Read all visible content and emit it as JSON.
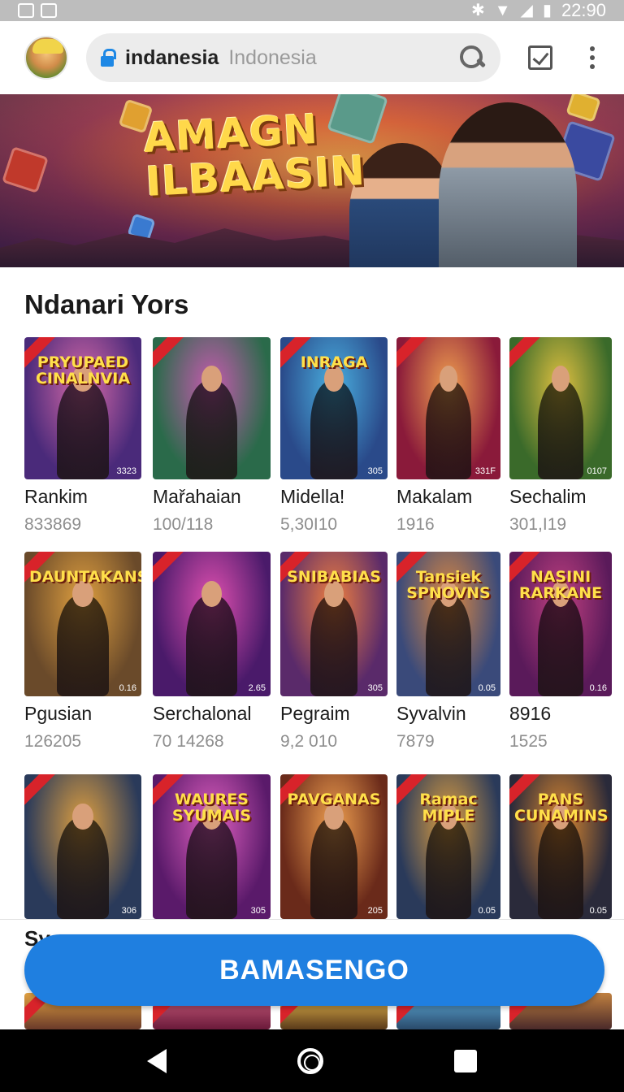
{
  "status_bar": {
    "time": "22:90",
    "icons": [
      "notification-icon",
      "notification-icon",
      "bluetooth-icon",
      "wifi-icon",
      "signal-icon",
      "battery-icon"
    ]
  },
  "app_bar": {
    "search_query": "indanesia",
    "search_hint": "Indonesia",
    "icons": [
      "avatar",
      "lock-icon",
      "search-icon",
      "checkbox-icon",
      "more-vert-icon"
    ]
  },
  "banner": {
    "title_line1": "AMAGN",
    "title_line2": "ILBAASIN"
  },
  "section": {
    "title": "Ndanari Yors"
  },
  "rows": [
    [
      {
        "poster_title": "PRYUPAED CINALNVIA",
        "poster_num": "3323",
        "name": "Rankim",
        "count": "833869",
        "colors": [
          "#4a2a7a",
          "#d86aa8"
        ]
      },
      {
        "poster_title": "",
        "poster_num": "",
        "name": "Mařahaian",
        "count": "100/118",
        "colors": [
          "#2a6a4a",
          "#c85ab0"
        ]
      },
      {
        "poster_title": "INRAGA",
        "poster_num": "305",
        "name": "Midellaǃ",
        "count": "5,30I10",
        "colors": [
          "#2a4a8a",
          "#4ab0e0"
        ]
      },
      {
        "poster_title": "",
        "poster_num": "331F",
        "name": "Makalam",
        "count": "1916",
        "colors": [
          "#8a1a3a",
          "#f0a050"
        ]
      },
      {
        "poster_title": "",
        "poster_num": "0107",
        "name": "Sechalim",
        "count": "301,I19",
        "colors": [
          "#3a6a2a",
          "#e0c040"
        ]
      }
    ],
    [
      {
        "poster_title": "DAUNTAKANS",
        "poster_num": "0.16",
        "name": "Pgusian",
        "count": "126205",
        "colors": [
          "#6a4a2a",
          "#e0a040"
        ]
      },
      {
        "poster_title": "",
        "poster_num": "2.65",
        "name": "Serchalonal",
        "count": "70 14268",
        "colors": [
          "#4a1a6a",
          "#e050b0"
        ]
      },
      {
        "poster_title": "SNIBABIAS",
        "poster_num": "305",
        "name": "Pegraim",
        "count": "9,2 010",
        "colors": [
          "#5a2a6a",
          "#f08040"
        ]
      },
      {
        "poster_title": "Tansiek SPNOVNS",
        "poster_num": "0.05",
        "name": "Syvalvin",
        "count": "7879",
        "colors": [
          "#3a4a7a",
          "#e08a40"
        ]
      },
      {
        "poster_title": "NASINI RARKANE",
        "poster_num": "0.16",
        "name": "8916",
        "count": "1525",
        "colors": [
          "#5a1a5a",
          "#c04080"
        ]
      }
    ],
    [
      {
        "poster_title": "",
        "poster_num": "306",
        "name": "",
        "count": "",
        "colors": [
          "#2a3a5a",
          "#e0a040"
        ]
      },
      {
        "poster_title": "WAURES SYUMAIS",
        "poster_num": "305",
        "name": "",
        "count": "",
        "colors": [
          "#5a1a6a",
          "#e060c0"
        ]
      },
      {
        "poster_title": "PAVGANAS",
        "poster_num": "205",
        "name": "",
        "count": "",
        "colors": [
          "#6a2a1a",
          "#f0a050"
        ]
      },
      {
        "poster_title": "Ramac MIPLE",
        "poster_num": "0.05",
        "name": "",
        "count": "",
        "colors": [
          "#2a3a5a",
          "#e0a040"
        ]
      },
      {
        "poster_title": "PANS CUNAMINS",
        "poster_num": "0.05",
        "name": "",
        "count": "",
        "colors": [
          "#2a2a3a",
          "#e08a30"
        ]
      }
    ]
  ],
  "cta": {
    "partial_label": "Sy",
    "button_label": "BAMASENGO"
  },
  "nav": {
    "icons": [
      "back-icon",
      "home-icon",
      "recents-icon"
    ]
  }
}
